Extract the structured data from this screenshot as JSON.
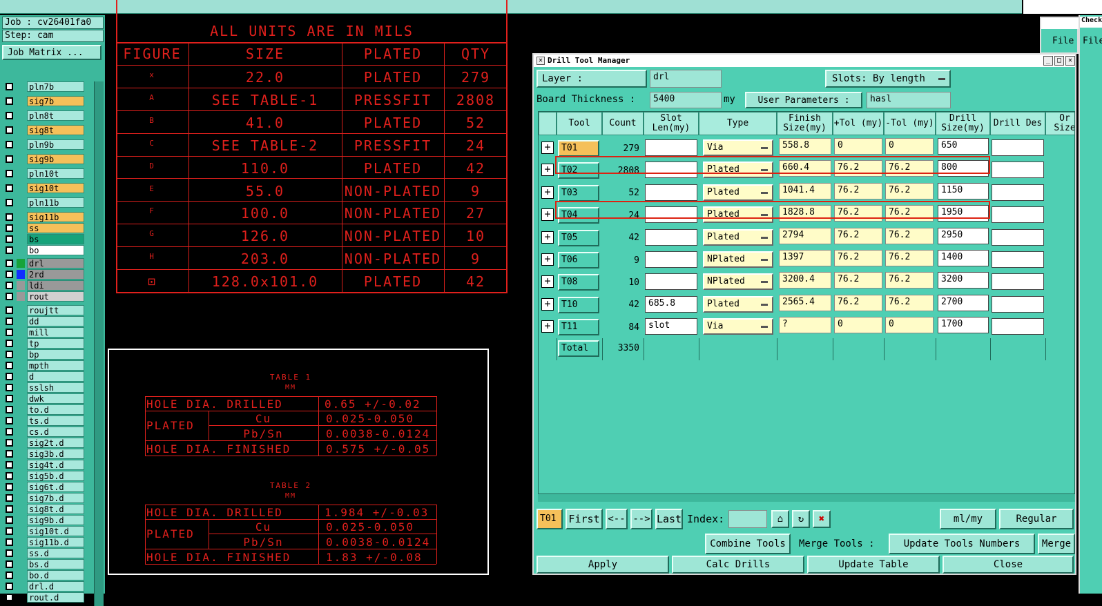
{
  "job": {
    "job_label": "Job : cv26401fa0",
    "step_label": "Step: cam",
    "matrix_button": "Job Matrix ..."
  },
  "layers": [
    {
      "name": "pln7b",
      "color": ""
    },
    {
      "name": "sig7b",
      "color": "#f5c05a"
    },
    {
      "name": "pln8t",
      "color": ""
    },
    {
      "name": "sig8t",
      "color": "#f5c05a"
    },
    {
      "name": "pln9b",
      "color": ""
    },
    {
      "name": "sig9b",
      "color": "#f5c05a"
    },
    {
      "name": "pln10t",
      "color": ""
    },
    {
      "name": "sig10t",
      "color": "#f5c05a"
    },
    {
      "name": "pln11b",
      "color": ""
    },
    {
      "name": "sig11b",
      "color": "#f5c05a"
    },
    {
      "name": "ss",
      "color": "#f5c05a"
    },
    {
      "name": "bs",
      "color": "#16a37a"
    },
    {
      "name": "bo",
      "color": "#ffffff"
    },
    {
      "name": "drl",
      "color": "#999999"
    },
    {
      "name": "2rd",
      "color": "#999999"
    },
    {
      "name": "ldi",
      "color": "#999999"
    },
    {
      "name": "rout",
      "color": "#d0d0d0"
    },
    {
      "name": "roujtt",
      "color": ""
    },
    {
      "name": "dd",
      "color": ""
    },
    {
      "name": "mill",
      "color": ""
    },
    {
      "name": "tp",
      "color": ""
    },
    {
      "name": "bp",
      "color": ""
    },
    {
      "name": "mpth",
      "color": ""
    },
    {
      "name": "d",
      "color": ""
    },
    {
      "name": "sslsh",
      "color": ""
    },
    {
      "name": "dwk",
      "color": ""
    },
    {
      "name": "to.d",
      "color": ""
    },
    {
      "name": "ts.d",
      "color": ""
    },
    {
      "name": "cs.d",
      "color": ""
    },
    {
      "name": "sig2t.d",
      "color": ""
    },
    {
      "name": "sig3b.d",
      "color": ""
    },
    {
      "name": "sig4t.d",
      "color": ""
    },
    {
      "name": "sig5b.d",
      "color": ""
    },
    {
      "name": "sig6t.d",
      "color": ""
    },
    {
      "name": "sig7b.d",
      "color": ""
    },
    {
      "name": "sig8t.d",
      "color": ""
    },
    {
      "name": "sig9b.d",
      "color": ""
    },
    {
      "name": "sig10t.d",
      "color": ""
    },
    {
      "name": "sig11b.d",
      "color": ""
    },
    {
      "name": "ss.d",
      "color": ""
    },
    {
      "name": "bs.d",
      "color": ""
    },
    {
      "name": "bo.d",
      "color": ""
    },
    {
      "name": "drl.d",
      "color": ""
    },
    {
      "name": "rout.d",
      "color": ""
    }
  ],
  "drill_chart": {
    "units_note": "ALL UNITS ARE IN MILS",
    "headers": [
      "FIGURE",
      "SIZE",
      "PLATED",
      "QTY"
    ],
    "rows": [
      {
        "fig": "x",
        "size": "22.0",
        "plated": "PLATED",
        "qty": "279"
      },
      {
        "fig": "A",
        "size": "SEE TABLE-1",
        "plated": "PRESSFIT",
        "qty": "2808"
      },
      {
        "fig": "B",
        "size": "41.0",
        "plated": "PLATED",
        "qty": "52"
      },
      {
        "fig": "C",
        "size": "SEE TABLE-2",
        "plated": "PRESSFIT",
        "qty": "24"
      },
      {
        "fig": "D",
        "size": "110.0",
        "plated": "PLATED",
        "qty": "42"
      },
      {
        "fig": "E",
        "size": "55.0",
        "plated": "NON-PLATED",
        "qty": "9"
      },
      {
        "fig": "F",
        "size": "100.0",
        "plated": "NON-PLATED",
        "qty": "27"
      },
      {
        "fig": "G",
        "size": "126.0",
        "plated": "NON-PLATED",
        "qty": "10"
      },
      {
        "fig": "H",
        "size": "203.0",
        "plated": "NON-PLATED",
        "qty": "9"
      },
      {
        "fig": "⊡",
        "size": "128.0x101.0",
        "plated": "PLATED",
        "qty": "42"
      }
    ]
  },
  "tables": [
    {
      "title": "TABLE 1",
      "unit": "MM",
      "drilled_label": "HOLE DIA. DRILLED",
      "drilled": "0.65 +/-0.02",
      "plated_label": "PLATED",
      "cu_label": "Cu",
      "cu": "0.025-0.050",
      "pbsn_label": "Pb/Sn",
      "pbsn": "0.0038-0.0124",
      "finished_label": "HOLE DIA. FINISHED",
      "finished": "0.575 +/-0.05"
    },
    {
      "title": "TABLE 2",
      "unit": "MM",
      "drilled_label": "HOLE DIA. DRILLED",
      "drilled": "1.984 +/-0.03",
      "plated_label": "PLATED",
      "cu_label": "Cu",
      "cu": "0.025-0.050",
      "pbsn_label": "Pb/Sn",
      "pbsn": "0.0038-0.0124",
      "finished_label": "HOLE DIA. FINISHED",
      "finished": "1.83 +/-0.08"
    }
  ],
  "dtm": {
    "title": "Drill Tool Manager",
    "layer_label": "Layer          :",
    "layer_value": "drl",
    "slots_label": "Slots:",
    "slots_value": "By length",
    "board_label": "Board Thickness :",
    "board_value": "5400",
    "board_unit": "my",
    "userparams_label": "User Parameters :",
    "userparams_value": "hasl",
    "columns": [
      "Tool",
      "Count",
      "Slot Len(my)",
      "Type",
      "Finish Size(my)",
      "+Tol (my)",
      "-Tol (my)",
      "Drill Size(my)",
      "Drill Des",
      "Or Size"
    ],
    "rows": [
      {
        "tool": "T01",
        "count": "279",
        "slot": "",
        "type": "Via",
        "finish": "558.8",
        "ptol": "0",
        "mtol": "0",
        "drill": "650",
        "des": "",
        "active": true
      },
      {
        "tool": "T02",
        "count": "2808",
        "slot": "",
        "type": "Plated",
        "finish": "660.4",
        "ptol": "76.2",
        "mtol": "76.2",
        "drill": "800",
        "des": "",
        "active": false
      },
      {
        "tool": "T03",
        "count": "52",
        "slot": "",
        "type": "Plated",
        "finish": "1041.4",
        "ptol": "76.2",
        "mtol": "76.2",
        "drill": "1150",
        "des": "",
        "active": false
      },
      {
        "tool": "T04",
        "count": "24",
        "slot": "",
        "type": "Plated",
        "finish": "1828.8",
        "ptol": "76.2",
        "mtol": "76.2",
        "drill": "1950",
        "des": "",
        "active": false
      },
      {
        "tool": "T05",
        "count": "42",
        "slot": "",
        "type": "Plated",
        "finish": "2794",
        "ptol": "76.2",
        "mtol": "76.2",
        "drill": "2950",
        "des": "",
        "active": false
      },
      {
        "tool": "T06",
        "count": "9",
        "slot": "",
        "type": "NPlated",
        "finish": "1397",
        "ptol": "76.2",
        "mtol": "76.2",
        "drill": "1400",
        "des": "",
        "active": false
      },
      {
        "tool": "T08",
        "count": "10",
        "slot": "",
        "type": "NPlated",
        "finish": "3200.4",
        "ptol": "76.2",
        "mtol": "76.2",
        "drill": "3200",
        "des": "",
        "active": false
      },
      {
        "tool": "T10",
        "count": "42",
        "slot": "685.8",
        "type": "Plated",
        "finish": "2565.4",
        "ptol": "76.2",
        "mtol": "76.2",
        "drill": "2700",
        "des": "",
        "active": false
      },
      {
        "tool": "T11",
        "count": "84",
        "slot": "slot",
        "type": "Via",
        "finish": "?",
        "ptol": "0",
        "mtol": "0",
        "drill": "1700",
        "des": "",
        "active": false
      }
    ],
    "total_label": "Total",
    "total_count": "3350",
    "nav": {
      "current": "T01",
      "first": "First",
      "prev": "<--",
      "next": "-->",
      "last": "Last",
      "index_label": "Index:",
      "units": "ml/my",
      "mode": "Regular"
    },
    "actions": {
      "combine": "Combine Tools",
      "merge_label": "Merge Tools :",
      "update_numbers": "Update Tools Numbers",
      "merge": "Merge",
      "apply": "Apply",
      "calc": "Calc Drills",
      "update_table": "Update Table",
      "close": "Close"
    }
  },
  "checklist": {
    "title": "Checkl",
    "file_menu": "File"
  }
}
